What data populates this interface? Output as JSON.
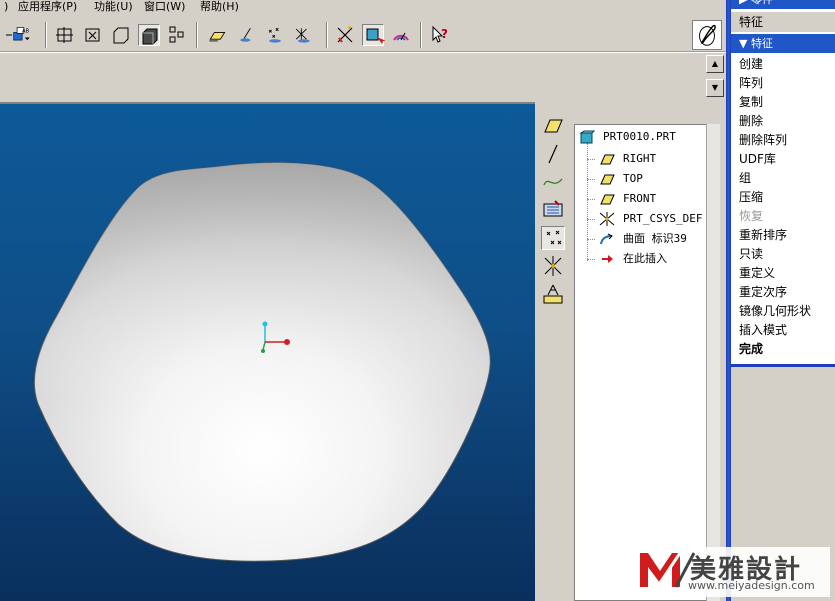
{
  "menubar": {
    "items": [
      "",
      "应用程序(P)",
      "功能(U)",
      "窗口(W)",
      "帮助(H)"
    ]
  },
  "toolbar": {
    "icons": [
      "save-dropdown-icon",
      "view-orient-icon",
      "view-refit-icon",
      "zoom-box-icon",
      "shading-icon",
      "hidden-line-icon",
      "datum-plane-display-icon",
      "datum-axis-display-icon",
      "datum-point-display-icon",
      "coordinate-system-display-icon",
      "spin-center-icon",
      "orient-mode-icon",
      "analysis-icon",
      "context-help-icon",
      "regen-icon"
    ]
  },
  "model_tree": {
    "items": [
      {
        "label": "PRT0010.PRT",
        "icon": "part-icon"
      },
      {
        "label": "RIGHT",
        "icon": "datum-plane-icon"
      },
      {
        "label": "TOP",
        "icon": "datum-plane-icon"
      },
      {
        "label": "FRONT",
        "icon": "datum-plane-icon"
      },
      {
        "label": "PRT_CSYS_DEF",
        "icon": "csys-icon"
      },
      {
        "label": "曲面 标识39",
        "icon": "surface-icon"
      },
      {
        "label": "在此插入",
        "icon": "insert-here-arrow-icon"
      }
    ]
  },
  "menu_manager": {
    "top_head": "零件",
    "top_gray": "特征",
    "section_head": "特征",
    "items": [
      {
        "label": "创建",
        "state": "normal"
      },
      {
        "label": "阵列",
        "state": "normal"
      },
      {
        "label": "复制",
        "state": "normal"
      },
      {
        "label": "删除",
        "state": "normal"
      },
      {
        "label": "删除阵列",
        "state": "normal"
      },
      {
        "label": "UDF库",
        "state": "normal"
      },
      {
        "label": "组",
        "state": "normal"
      },
      {
        "label": "压缩",
        "state": "normal"
      },
      {
        "label": "恢复",
        "state": "disabled"
      },
      {
        "label": "重新排序",
        "state": "normal"
      },
      {
        "label": "只读",
        "state": "normal"
      },
      {
        "label": "重定义",
        "state": "normal"
      },
      {
        "label": "重定次序",
        "state": "normal"
      },
      {
        "label": "镜像几何形状",
        "state": "normal"
      },
      {
        "label": "插入模式",
        "state": "normal"
      },
      {
        "label": "完成",
        "state": "bold"
      }
    ]
  },
  "watermark": {
    "cn": "美雅設計",
    "url": "www.meiyadesign.com"
  },
  "colors": {
    "viewport_top": "#0d5a98",
    "viewport_bottom": "#0a2f5c",
    "menu_accent": "#1f57c8"
  }
}
